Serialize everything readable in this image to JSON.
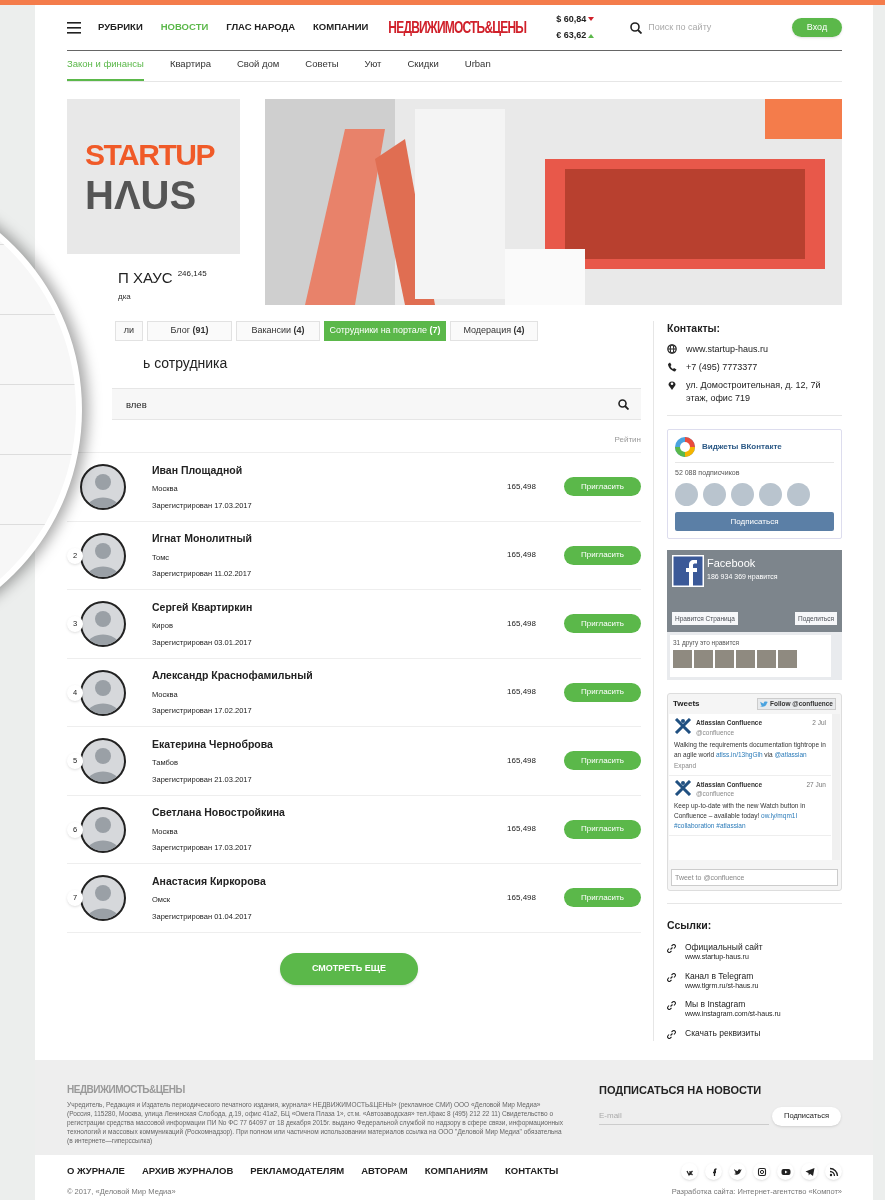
{
  "header": {
    "nav": [
      {
        "label": "РУБРИКИ",
        "selected": false
      },
      {
        "label": "НОВОСТИ",
        "selected": true
      },
      {
        "label": "ГЛАС НАРОДА",
        "selected": false
      },
      {
        "label": "КОМПАНИИ",
        "selected": false
      }
    ],
    "logo": "НЕДВИЖИМОСТЬ&ЦЕНЫ",
    "rates": [
      {
        "value": "$ 60,84",
        "rising": false
      },
      {
        "value": "€ 63,62",
        "rising": true
      }
    ],
    "search": {
      "placeholder": "Поиск по сайту"
    },
    "login": "Вход"
  },
  "subnav": [
    {
      "label": "Закон и финансы",
      "selected": true
    },
    {
      "label": "Квартира",
      "selected": false
    },
    {
      "label": "Свой дом",
      "selected": false
    },
    {
      "label": "Советы",
      "selected": false
    },
    {
      "label": "Уют",
      "selected": false
    },
    {
      "label": "Скидки",
      "selected": false
    },
    {
      "label": "Urban",
      "selected": false
    }
  ],
  "company": {
    "logo_top": "STARTUP",
    "logo_bottom": "HΛUS",
    "name": "П ХАУС",
    "rating": "246,145",
    "type": "дка"
  },
  "tabs": [
    {
      "label": "ли",
      "selected": false
    },
    {
      "label": "Блог **(91)**",
      "selected": false
    },
    {
      "label": "Вакансии **(4)**",
      "selected": false
    },
    {
      "label": "Сотрудники на портале **(7)**",
      "selected": true
    },
    {
      "label": "Модерация **(4)**",
      "selected": false
    }
  ],
  "section_title": "ь сотрудника",
  "search": {
    "value": "влев"
  },
  "rating_header": "Рейтин",
  "employees": [
    {
      "name": "Иван Площадной",
      "city": "Москва",
      "registered": "Зарегистрирован 17.03.2017",
      "rating": "165,498",
      "action": "Пригласить"
    },
    {
      "number": "2",
      "name": "Игнат Монолитный",
      "city": "Томс",
      "registered": "Зарегистрирован 11.02.2017",
      "rating": "165,498",
      "action": "Пригласить"
    },
    {
      "number": "3",
      "name": "Сергей Квартиркин",
      "city": "Киров",
      "registered": "Зарегистрирован 03.01.2017",
      "rating": "165,498",
      "action": "Пригласить"
    },
    {
      "number": "4",
      "name": "Александр Краснофамильный",
      "city": "Москва",
      "registered": "Зарегистрирован 17.02.2017",
      "rating": "165,498",
      "action": "Пригласить"
    },
    {
      "number": "5",
      "name": "Екатерина Черноброва",
      "city": "Тамбов",
      "registered": "Зарегистрирован 21.03.2017",
      "rating": "165,498",
      "action": "Пригласить"
    },
    {
      "number": "6",
      "name": "Светлана Новостройкина",
      "city": "Москва",
      "registered": "Зарегистрирован 17.03.2017",
      "rating": "165,498",
      "action": "Пригласить"
    },
    {
      "number": "7",
      "name": "Анастасия Киркорова",
      "city": "Омск",
      "registered": "Зарегистрирован 01.04.2017",
      "rating": "165,498",
      "action": "Пригласить"
    }
  ],
  "more_button": "СМОТРЕТЬ ЕЩЕ",
  "sidebar": {
    "contacts_title": "Контакты:",
    "contacts": [
      {
        "kind": "web",
        "text": "www.startup-haus.ru"
      },
      {
        "kind": "phone",
        "text": "+7 (495) 7773377"
      },
      {
        "kind": "address",
        "text": "ул. Домостроительная, д. 12, 7й этаж, офис 719"
      }
    ],
    "vk": {
      "title": "Виджеты ВКонтакте",
      "subscribers": "52 088 подписчиков",
      "button": "Подписаться"
    },
    "facebook": {
      "title": "Facebook",
      "likes": "186 934 369 нравится",
      "like_button": "Нравится Страница",
      "share_button": "Поделиться",
      "friends": "31 другу это нравится"
    },
    "twitter": {
      "title": "Tweets",
      "follow": "Follow @confluence",
      "tweets": [
        {
          "author": "Atlassian Confluence",
          "handle": "@confluence",
          "date": "2 Jul",
          "body": [
            {
              "kind": "text",
              "text": "Walking the requirements documentation tightrope in an agile world"
            },
            {
              "kind": "link",
              "text": "atlss.in/13hgGlh"
            },
            {
              "kind": "text",
              "text": "via"
            },
            {
              "kind": "link",
              "text": "@atlassian"
            }
          ],
          "expand": "Expand"
        },
        {
          "author": "Atlassian Confluence",
          "handle": "@confluence",
          "date": "27 Jun",
          "body": [
            {
              "kind": "text",
              "text": "Keep up-to-date with the new Watch button in Confluence – available today!"
            },
            {
              "kind": "link",
              "text": "ow.ly/mqm1I"
            },
            {
              "kind": "link",
              "text": "#collaboration"
            },
            {
              "kind": "link",
              "text": "#atlassian"
            }
          ]
        }
      ],
      "placeholder": "Tweet to @confluence"
    },
    "links_title": "Ссылки:",
    "links": [
      {
        "title": "Официальный сайт",
        "url": "www.startup-haus.ru"
      },
      {
        "title": "Канал в Telegram",
        "url": "www.tlgrm.ru/st-haus.ru"
      },
      {
        "title": "Мы в Instagram",
        "url": "www.instagram.com/st-haus.ru"
      },
      {
        "title": "Скачать реквизиты"
      }
    ]
  },
  "footer": {
    "logo": "НЕДВИЖИМОСТЬ&ЦЕНЫ",
    "legal": "Учредитель, Редакция и Издатель периодического печатного издания, журнала« НЕДВИЖИМОСТЬ&ЦЕНЫ» (рекламное СМИ) ООО «Деловой Мир Медиа» (Россия, 115280, Москва, улица Ленинская Слобода, д.19, офис 41а2, БЦ «Омега Плаза 1», ст.м. «Автозаводская» тел./факс 8 (495) 212 22 11) Свидетельство о регистрации средства массовой информации ПИ No ФС 77 64097 от 18 декабря 2015г. выдано Федеральной службой по надзору в сфере связи, информационных технологий и массовых коммуникаций (Роскомнадзор). При полном или частичном использовании материалов ссылка на ООО \"Деловой Мир Медиа\" обязательна (в интернете—гиперссылка)",
    "subscribe_title": "ПОДПИСАТЬСЯ НА НОВОСТИ",
    "email_placeholder": "E-mail",
    "subscribe_button": "Подписаться",
    "nav": [
      "О ЖУРНАЛЕ",
      "АРХИВ ЖУРНАЛОВ",
      "РЕКЛАМОДАТЕЛЯМ",
      "АВТОРАМ",
      "КОМПАНИЯМ",
      "КОНТАКТЫ"
    ],
    "social": [
      {
        "kind": "vk"
      },
      {
        "kind": "facebook"
      },
      {
        "kind": "twitter"
      },
      {
        "kind": "instagram"
      },
      {
        "kind": "youtube"
      },
      {
        "kind": "telegram"
      },
      {
        "kind": "rss"
      }
    ],
    "copyright": "© 2017, «Деловой Мир Медиа»",
    "developer": "Разработка сайта: Интернет-агентство «Компот»"
  }
}
